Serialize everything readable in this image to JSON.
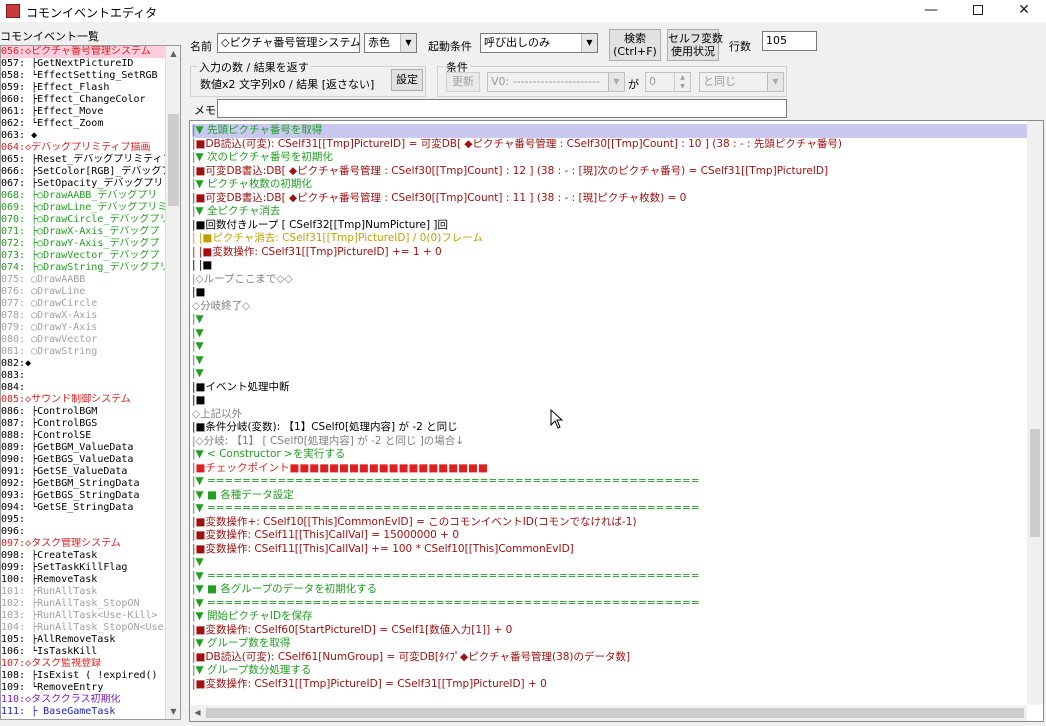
{
  "window": {
    "title": "コモンイベントエディタ",
    "minimize": "—",
    "close": "✕"
  },
  "left": {
    "title": "コモンイベント一覧",
    "rows": [
      {
        "text": "056:◇ピクチャ番号管理システム",
        "color": "#e02020",
        "selected": true
      },
      {
        "text": "057: ├GetNextPictureID",
        "color": "#000000"
      },
      {
        "text": "058: └EffectSetting_SetRGB",
        "color": "#000000"
      },
      {
        "text": "059:    ├Effect_Flash",
        "color": "#000000"
      },
      {
        "text": "060:    ├Effect_ChangeColor",
        "color": "#000000"
      },
      {
        "text": "061:    ├Effect_Move",
        "color": "#000000"
      },
      {
        "text": "062:    └Effect_Zoom",
        "color": "#000000"
      },
      {
        "text": "063:  ◆",
        "color": "#000000"
      },
      {
        "text": "064:◇デバッグプリミティブ描画",
        "color": "#e02020"
      },
      {
        "text": "065: ├Reset_デバッグプリミティブ",
        "color": "#000000"
      },
      {
        "text": "066: ├SetColor[RGB]_デバッグプリ",
        "color": "#000000"
      },
      {
        "text": "067: ├SetOpacity_デバッグプリミ",
        "color": "#000000"
      },
      {
        "text": "068: ├○DrawAABB_デバッグプリ",
        "color": "#20a020"
      },
      {
        "text": "069: ├○DrawLine_デバッグプリミ",
        "color": "#20a020"
      },
      {
        "text": "070: ├○DrawCircle_デバッグプリ",
        "color": "#20a020"
      },
      {
        "text": "071: ├○DrawX-Axis_デバッグプ",
        "color": "#20a020"
      },
      {
        "text": "072: ├○DrawY-Axis_デバッグプ",
        "color": "#20a020"
      },
      {
        "text": "073: ├○DrawVector_デバッグプ",
        "color": "#20a020"
      },
      {
        "text": "074: ├○DrawString_デバッグプリ",
        "color": "#20a020"
      },
      {
        "text": "075: ○DrawAABB",
        "color": "#a0a0a0"
      },
      {
        "text": "076: ○DrawLine",
        "color": "#a0a0a0"
      },
      {
        "text": "077: ○DrawCircle",
        "color": "#a0a0a0"
      },
      {
        "text": "078: ○DrawX-Axis",
        "color": "#a0a0a0"
      },
      {
        "text": "079: ○DrawY-Axis",
        "color": "#a0a0a0"
      },
      {
        "text": "080: ○DrawVector",
        "color": "#a0a0a0"
      },
      {
        "text": "081: ○DrawString",
        "color": "#a0a0a0"
      },
      {
        "text": "082:◆",
        "color": "#000000"
      },
      {
        "text": "083:",
        "color": "#000000"
      },
      {
        "text": "084:",
        "color": "#000000"
      },
      {
        "text": "085:◇サウンド制御システム",
        "color": "#e02020"
      },
      {
        "text": "086: ├ControlBGM",
        "color": "#000000"
      },
      {
        "text": "087: ├ControlBGS",
        "color": "#000000"
      },
      {
        "text": "088: ├ControlSE",
        "color": "#000000"
      },
      {
        "text": "089: ├GetBGM_ValueData",
        "color": "#000000"
      },
      {
        "text": "090: ├GetBGS_ValueData",
        "color": "#000000"
      },
      {
        "text": "091: ├GetSE_ValueData",
        "color": "#000000"
      },
      {
        "text": "092: ├GetBGM_StringData",
        "color": "#000000"
      },
      {
        "text": "093: ├GetBGS_StringData",
        "color": "#000000"
      },
      {
        "text": "094: └GetSE_StringData",
        "color": "#000000"
      },
      {
        "text": "095:",
        "color": "#000000"
      },
      {
        "text": "096:",
        "color": "#000000"
      },
      {
        "text": "097:◇タスク管理システム",
        "color": "#e02020"
      },
      {
        "text": "098: ├CreateTask",
        "color": "#000000"
      },
      {
        "text": "099: ├SetTaskKillFlag",
        "color": "#000000"
      },
      {
        "text": "100: ├RemoveTask",
        "color": "#000000"
      },
      {
        "text": "101: ├RunAllTask",
        "color": "#a0a0a0"
      },
      {
        "text": "102: ├RunAllTask_StopON",
        "color": "#a0a0a0"
      },
      {
        "text": "103: ├RunAllTask<Use-Kill>",
        "color": "#a0a0a0"
      },
      {
        "text": "104: ├RunAllTask_StopON<Use-",
        "color": "#a0a0a0"
      },
      {
        "text": "105: ├AllRemoveTask",
        "color": "#000000"
      },
      {
        "text": "106: └IsTaskKill",
        "color": "#000000"
      },
      {
        "text": "107:◇タスク監視登録",
        "color": "#e02020"
      },
      {
        "text": "108:    ├IsExist ( !expired() )",
        "color": "#000000"
      },
      {
        "text": "109:    └RemoveEntry",
        "color": "#000000"
      },
      {
        "text": "110:◇タスククラス初期化",
        "color": "#8020c0"
      },
      {
        "text": "111: ├ BaseGameTask",
        "color": "#2020c0"
      }
    ]
  },
  "top": {
    "name_label": "名前",
    "name_value": "◇ピクチャ番号管理システム",
    "color_value": "赤色",
    "trigger_label": "起動条件",
    "trigger_value": "呼び出しのみ",
    "search_button": "検索\n(Ctrl+F)",
    "selfvar_button": "セルフ変数\n使用状況",
    "lines_label": "行数",
    "lines_value": "105",
    "io_group_title": "入力の数 / 結果を返す",
    "io_text": "数値x2 文字列x0 / 結果 [返さない]",
    "setting_button": "設定",
    "cond_group_title": "条件",
    "update_button": "更新",
    "cond_var_value": "V0: ----------------------",
    "ga_label": "が",
    "cond_num_value": "0",
    "cond_op_value": "と同じ",
    "memo_label": "メモ",
    "memo_value": ""
  },
  "code": {
    "rows": [
      {
        "text": "|▼ 先頭ピクチャ番号を取得",
        "color": "#20a020",
        "selected": true
      },
      {
        "text": "|■DB読込(可変): CSelf31[[Tmp]PictureID] = 可変DB[ ◆ピクチャ番号管理 : CSelf30[[Tmp]Count] : 10 ] (38 : - : 先頭ピクチャ番号)",
        "color": "#a01010"
      },
      {
        "text": "|▼ 次のピクチャ番号を初期化",
        "color": "#20a020"
      },
      {
        "text": "|■可変DB書込:DB[ ◆ピクチャ番号管理 : CSelf30[[Tmp]Count] : 12 ] (38 : - : [現]次のピクチャ番号) = CSelf31[[Tmp]PictureID]",
        "color": "#a01010"
      },
      {
        "text": "|▼ ピクチャ枚数の初期化",
        "color": "#20a020"
      },
      {
        "text": "|■可変DB書込:DB[ ◆ピクチャ番号管理 : CSelf30[[Tmp]Count] : 11 ] (38 : - : [現]ピクチャ枚数) = 0",
        "color": "#a01010"
      },
      {
        "text": "|▼ 全ピクチャ消去",
        "color": "#20a020"
      },
      {
        "text": "|■回数付きループ [ CSelf32[[Tmp]NumPicture] ]回",
        "color": "#000000"
      },
      {
        "text": "| |■ピクチャ消去: CSelf31[[Tmp]PictureID] / 0(0)フレーム",
        "color": "#c0a000"
      },
      {
        "text": "| |■変数操作: CSelf31[[Tmp]PictureID] += 1 + 0",
        "color": "#a01010"
      },
      {
        "text": "| |■",
        "color": "#000000"
      },
      {
        "text": "|◇ループここまで◇◇",
        "color": "#808080"
      },
      {
        "text": "|■",
        "color": "#000000"
      },
      {
        "text": "◇分岐終了◇",
        "color": "#808080"
      },
      {
        "text": "|▼",
        "color": "#20a020"
      },
      {
        "text": "|▼",
        "color": "#20a020"
      },
      {
        "text": "|▼",
        "color": "#20a020"
      },
      {
        "text": "|▼",
        "color": "#20a020"
      },
      {
        "text": "|▼",
        "color": "#20a020"
      },
      {
        "text": "|■イベント処理中断",
        "color": "#000000"
      },
      {
        "text": "|■",
        "color": "#000000"
      },
      {
        "text": "◇上記以外",
        "color": "#808080"
      },
      {
        "text": "|■条件分岐(変数): 【1】CSelf0[処理内容] が -2 と同じ",
        "color": "#000000"
      },
      {
        "text": "|◇分岐: 【1】 [ CSelf0[処理内容] が -2 と同じ ]の場合↓",
        "color": "#808080"
      },
      {
        "text": "|▼ < Constructor >を実行する",
        "color": "#20a020"
      },
      {
        "text": "|■チェックポイント■■■■■■■■■■■■■■■■■■■■",
        "color": "#e02020"
      },
      {
        "text": "|▼ ========================================================",
        "color": "#20a020"
      },
      {
        "text": "|▼ ■ 各種データ設定",
        "color": "#20a020"
      },
      {
        "text": "|▼ ========================================================",
        "color": "#20a020"
      },
      {
        "text": "|■変数操作+: CSelf10[[This]CommonEvID] = このコモンイベントID(コモンでなければ-1)",
        "color": "#a01010"
      },
      {
        "text": "|■変数操作: CSelf11[[This]CallVal] = 15000000 + 0",
        "color": "#a01010"
      },
      {
        "text": "|■変数操作: CSelf11[[This]CallVal] += 100 * CSelf10[[This]CommonEvID]",
        "color": "#a01010"
      },
      {
        "text": "|▼",
        "color": "#20a020"
      },
      {
        "text": "|▼ ========================================================",
        "color": "#20a020"
      },
      {
        "text": "|▼ ■ 各グループのデータを初期化する",
        "color": "#20a020"
      },
      {
        "text": "|▼ ========================================================",
        "color": "#20a020"
      },
      {
        "text": "|▼ 開始ピクチャIDを保存",
        "color": "#20a020"
      },
      {
        "text": "|■変数操作: CSelf60[StartPictureID] = CSelf1[数値入力[1]] + 0",
        "color": "#a01010"
      },
      {
        "text": "|▼ グループ数を取得",
        "color": "#20a020"
      },
      {
        "text": "|■DB読込(可変): CSelf61[NumGroup] = 可変DB[ﾀｲﾌﾟ◆ピクチャ番号管理(38)のデータ数]",
        "color": "#a01010"
      },
      {
        "text": "|▼ グループ数分処理する",
        "color": "#20a020"
      },
      {
        "text": "|■変数操作: CSelf31[[Tmp]PictureID] = CSelf31[[Tmp]PictureID] + 0",
        "color": "#a01010"
      }
    ]
  }
}
